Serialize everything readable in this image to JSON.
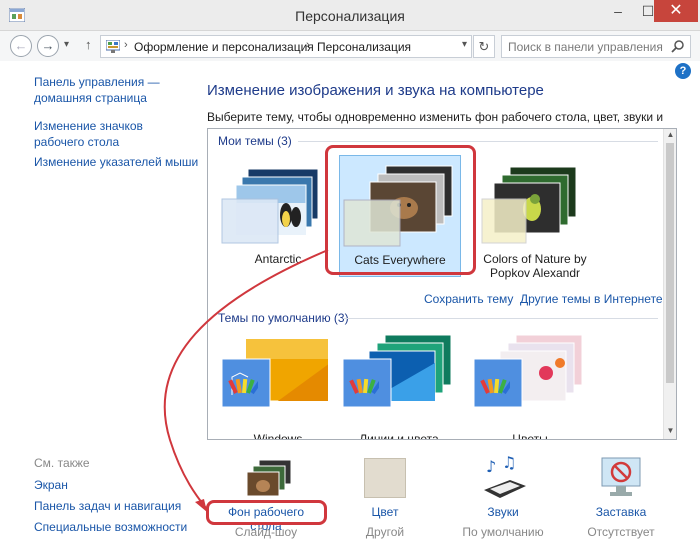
{
  "window": {
    "title": "Персонализация",
    "min_glyph": "–",
    "max_glyph": "☐",
    "close_glyph": "✕"
  },
  "addressbar": {
    "crumbs": [
      "Оформление и персонализация",
      "Персонализация"
    ],
    "search_placeholder": "Поиск в панели управления"
  },
  "leftnav": {
    "home_line1": "Панель управления —",
    "home_line2": "домашняя страница",
    "icons_line1": "Изменение значков",
    "icons_line2": "рабочего стола",
    "pointers": "Изменение указателей мыши",
    "see_also": "См. также",
    "screen": "Экран",
    "taskbar": "Панель задач и навигация",
    "accessibility": "Специальные возможности"
  },
  "main": {
    "title": "Изменение изображения и звука на компьютере",
    "description": "Выберите тему, чтобы одновременно изменить фон рабочего стола, цвет, звуки и заставку.",
    "help": "?"
  },
  "my_themes": {
    "label": "Мои темы (3)",
    "items": [
      {
        "name": "Antarctic",
        "selected": false
      },
      {
        "name": "Cats Everywhere",
        "selected": true
      },
      {
        "name_line1": "Colors of Nature by",
        "name_line2": "Popkov Alexandr",
        "selected": false
      }
    ],
    "save_link": "Сохранить тему",
    "online_link": "Другие темы в Интернете"
  },
  "default_themes": {
    "label": "Темы по умолчанию (3)",
    "items": [
      {
        "name": "Windows"
      },
      {
        "name": "Линии и цвета"
      },
      {
        "name": "Цветы"
      }
    ]
  },
  "bottom": {
    "background": {
      "label": "Фон рабочего стола",
      "sub": "Слайд-шоу"
    },
    "color": {
      "label": "Цвет",
      "sub": "Другой",
      "swatch": "#e2dccf"
    },
    "sounds": {
      "label": "Звуки",
      "sub": "По умолчанию"
    },
    "screensaver": {
      "label": "Заставка",
      "sub": "Отсутствует"
    }
  },
  "colors": {
    "highlight": "#d0373d",
    "link": "#1a56a8",
    "title": "#1e3b8a",
    "selection": "#cce8ff"
  }
}
